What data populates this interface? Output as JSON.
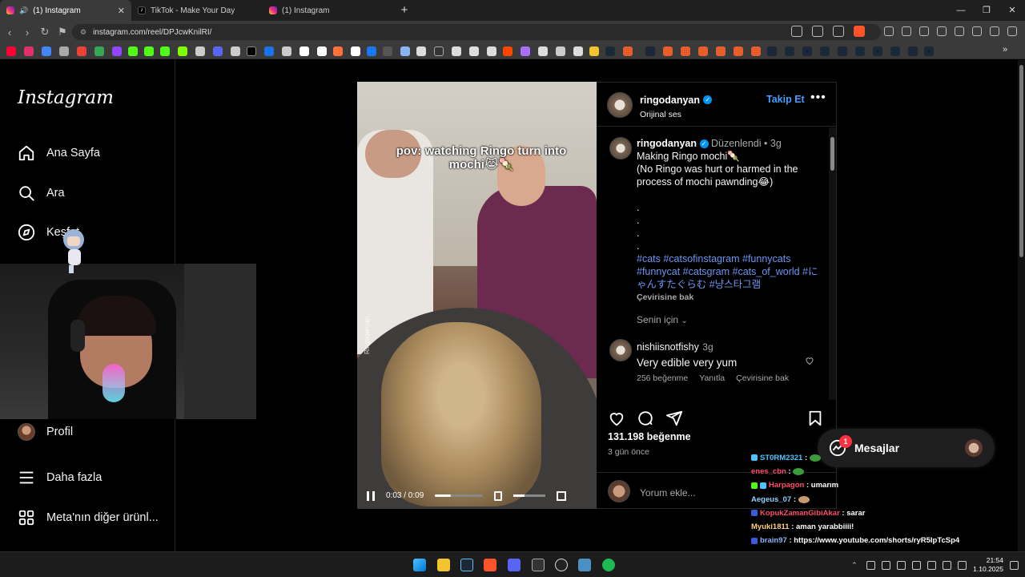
{
  "browser": {
    "tabs": [
      {
        "label": "(1) Instagram",
        "active": true
      },
      {
        "label": "TikTok - Make Your Day",
        "active": false
      },
      {
        "label": "(1) Instagram",
        "active": false
      }
    ],
    "url": "instagram.com/reel/DPJcwKnilRI/",
    "accent": "#fb542b"
  },
  "sidebar": {
    "logo": "Instagram",
    "items": [
      {
        "label": "Ana Sayfa",
        "icon": "home-icon"
      },
      {
        "label": "Ara",
        "icon": "search-icon"
      },
      {
        "label": "Keşfet",
        "icon": "compass-icon"
      },
      {
        "label": "Profil",
        "icon": "avatar"
      },
      {
        "label": "Daha fazla",
        "icon": "menu-icon"
      },
      {
        "label": "Meta'nın diğer ürünl...",
        "icon": "grid-icon"
      }
    ]
  },
  "reel": {
    "caption": "pov: watching Ringo turn into mochi😹🍡",
    "watermark": "Ringodanyan",
    "time": "0:03 / 0:09",
    "progress": 0.33,
    "volume": 0.35
  },
  "post": {
    "author": "ringodanyan",
    "audio": "Orijinal ses",
    "follow_label": "Takip Et",
    "more_label": "•••",
    "edited": "Düzenlendi",
    "age": "3g",
    "caption_lines": [
      "Making Ringo mochi🍡",
      "(No Ringo was hurt or harmed in the process of mochi pawnding😂)"
    ],
    "dots": [
      ".",
      ".",
      ".",
      "."
    ],
    "hashtags": "#cats #catsofinstagram #funnycats #funnycat #catsgram #cats_of_world #にゃんすたぐらむ #냥스타그램",
    "see_translation": "Çevirisine bak",
    "for_you": "Senin için",
    "likes": "131.198 beğenme",
    "posted_ago": "3 gün önce",
    "add_comment_placeholder": "Yorum ekle..."
  },
  "comment": {
    "user": "nishiisnotfishy",
    "age": "3g",
    "text": "Very edible very yum",
    "likes": "256 beğenme",
    "reply": "Yanıtla",
    "translate": "Çevirisine bak"
  },
  "messages": {
    "label": "Mesajlar",
    "badge": "1"
  },
  "chat": [
    {
      "user": "ST0RM2321",
      "color": "#4fc3ff",
      "text": ":"
    },
    {
      "user": "enes_cbn",
      "color": "#ff4d6d",
      "text": ":"
    },
    {
      "user": "Harpagon",
      "color": "#ff4d6d",
      "text": ": umarım"
    },
    {
      "user": "Aegeus_07",
      "color": "#8fd3ff",
      "text": ":"
    },
    {
      "user": "KopukZamanGibiAkar",
      "color": "#ff4d6d",
      "text": ": sarar"
    },
    {
      "user": "Myuki1811",
      "color": "#ffd27a",
      "text": ": aman yarabbiiii!"
    },
    {
      "user": "brain97",
      "color": "#8fb3ff",
      "text": ": https://www.youtube.com/shorts/ryR5IpTcSp4"
    }
  ],
  "taskbar": {
    "time": "21:54",
    "date": "1.10.2025"
  }
}
